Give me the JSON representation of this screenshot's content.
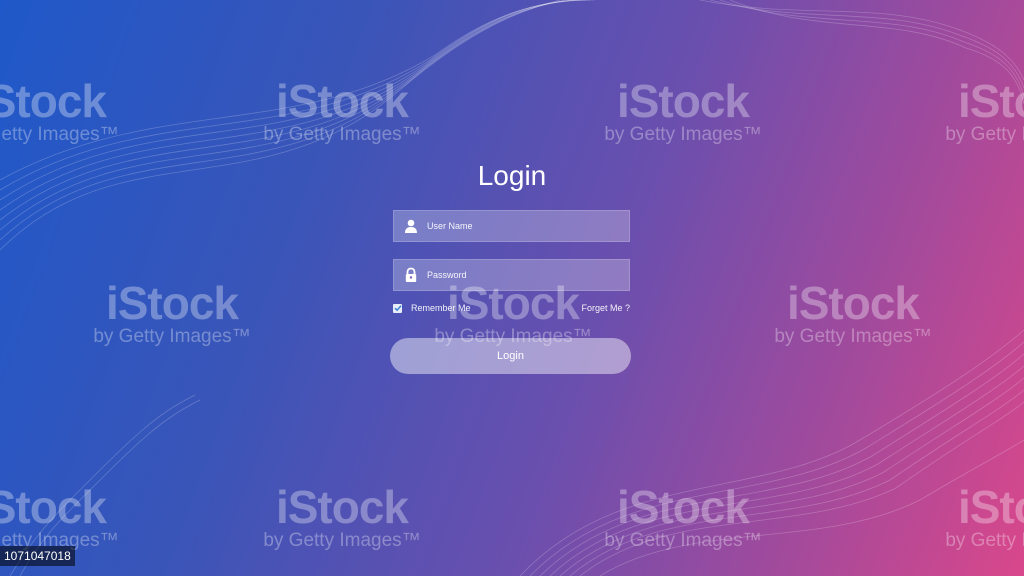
{
  "login": {
    "title": "Login",
    "username_placeholder": "User Name",
    "password_placeholder": "Password",
    "remember_label": "Remember Me",
    "remember_checked": true,
    "forgot_label": "Forget Me ?",
    "button_label": "Login"
  },
  "icons": {
    "username": "user-icon",
    "password": "lock-icon",
    "checkbox": "check-icon"
  },
  "watermark": {
    "brand": "iStock",
    "sub": "by Getty Images™"
  },
  "image_id": "1071047018",
  "colors": {
    "gradient_start": "#1f58c9",
    "gradient_end": "#d9478b",
    "checkbox_check": "#3d7fd6"
  }
}
